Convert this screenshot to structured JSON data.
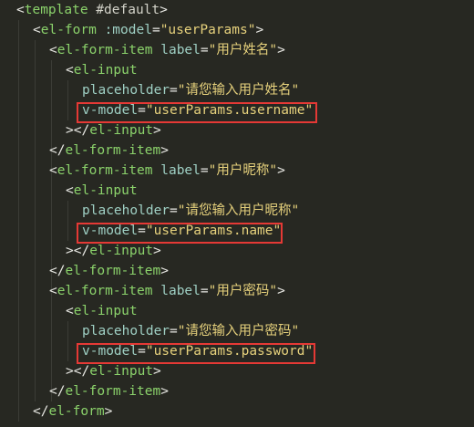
{
  "editor": {
    "colors": {
      "background": "#272822",
      "tag": "#8bd26b",
      "attribute": "#9fd0c4",
      "string": "#e6d17c",
      "punctuation": "#e7e7e2",
      "highlight_border": "#e53935"
    },
    "lines": [
      {
        "tokens": [
          [
            "p",
            "<"
          ],
          [
            "tg",
            "template"
          ],
          [
            "kw",
            " #default"
          ],
          [
            "p",
            ">"
          ]
        ]
      },
      {
        "tokens": [
          [
            "p",
            "<"
          ],
          [
            "tg",
            "el-form"
          ],
          [
            "at",
            " :model"
          ],
          [
            "p",
            "="
          ],
          [
            "st",
            "\"userParams\""
          ],
          [
            "p",
            ">"
          ]
        ]
      },
      {
        "tokens": [
          [
            "p",
            "<"
          ],
          [
            "tg",
            "el-form-item"
          ],
          [
            "at",
            " label"
          ],
          [
            "p",
            "="
          ],
          [
            "st",
            "\"用户姓名\""
          ],
          [
            "p",
            ">"
          ]
        ]
      },
      {
        "tokens": [
          [
            "p",
            "<"
          ],
          [
            "tg",
            "el-input"
          ]
        ]
      },
      {
        "tokens": [
          [
            "at",
            "placeholder"
          ],
          [
            "p",
            "="
          ],
          [
            "st",
            "\"请您输入用户姓名\""
          ]
        ]
      },
      {
        "tokens": [
          [
            "at",
            "v-model"
          ],
          [
            "p",
            "="
          ],
          [
            "st",
            "\"userParams.username\""
          ]
        ]
      },
      {
        "tokens": [
          [
            "p",
            "></"
          ],
          [
            "tg",
            "el-input"
          ],
          [
            "p",
            ">"
          ]
        ]
      },
      {
        "tokens": [
          [
            "p",
            "</"
          ],
          [
            "tg",
            "el-form-item"
          ],
          [
            "p",
            ">"
          ]
        ]
      },
      {
        "tokens": [
          [
            "p",
            "<"
          ],
          [
            "tg",
            "el-form-item"
          ],
          [
            "at",
            " label"
          ],
          [
            "p",
            "="
          ],
          [
            "st",
            "\"用户昵称\""
          ],
          [
            "p",
            ">"
          ]
        ]
      },
      {
        "tokens": [
          [
            "p",
            "<"
          ],
          [
            "tg",
            "el-input"
          ]
        ]
      },
      {
        "tokens": [
          [
            "at",
            "placeholder"
          ],
          [
            "p",
            "="
          ],
          [
            "st",
            "\"请您输入用户昵称\""
          ]
        ]
      },
      {
        "tokens": [
          [
            "at",
            "v-model"
          ],
          [
            "p",
            "="
          ],
          [
            "st",
            "\"userParams.name\""
          ]
        ]
      },
      {
        "tokens": [
          [
            "p",
            "></"
          ],
          [
            "tg",
            "el-input"
          ],
          [
            "p",
            ">"
          ]
        ]
      },
      {
        "tokens": [
          [
            "p",
            "</"
          ],
          [
            "tg",
            "el-form-item"
          ],
          [
            "p",
            ">"
          ]
        ]
      },
      {
        "tokens": [
          [
            "p",
            "<"
          ],
          [
            "tg",
            "el-form-item"
          ],
          [
            "at",
            " label"
          ],
          [
            "p",
            "="
          ],
          [
            "st",
            "\"用户密码\""
          ],
          [
            "p",
            ">"
          ]
        ]
      },
      {
        "tokens": [
          [
            "p",
            "<"
          ],
          [
            "tg",
            "el-input"
          ]
        ]
      },
      {
        "tokens": [
          [
            "at",
            "placeholder"
          ],
          [
            "p",
            "="
          ],
          [
            "st",
            "\"请您输入用户密码\""
          ]
        ]
      },
      {
        "tokens": [
          [
            "at",
            "v-model"
          ],
          [
            "p",
            "="
          ],
          [
            "st",
            "\"userParams.password\""
          ]
        ]
      },
      {
        "tokens": [
          [
            "p",
            "></"
          ],
          [
            "tg",
            "el-input"
          ],
          [
            "p",
            ">"
          ]
        ]
      },
      {
        "tokens": [
          [
            "p",
            "</"
          ],
          [
            "tg",
            "el-form-item"
          ],
          [
            "p",
            ">"
          ]
        ]
      },
      {
        "tokens": [
          [
            "p",
            "</"
          ],
          [
            "tg",
            "el-form"
          ],
          [
            "p",
            ">"
          ]
        ]
      }
    ]
  }
}
